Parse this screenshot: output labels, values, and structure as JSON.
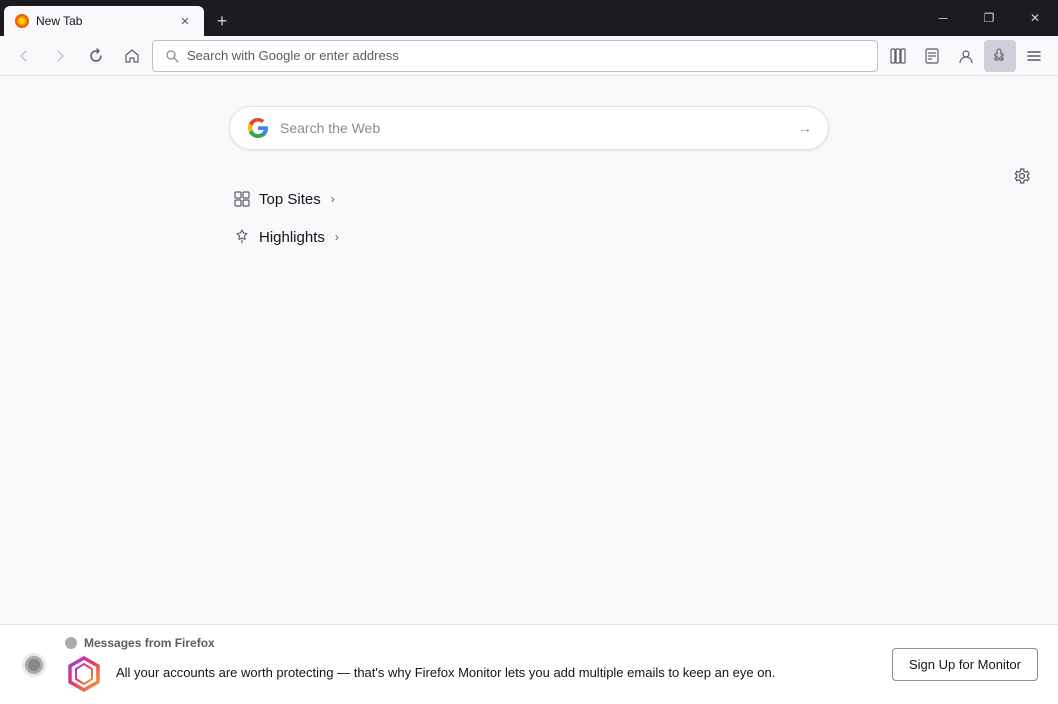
{
  "titlebar": {
    "tab": {
      "title": "New Tab",
      "favicon_char": "🦊"
    },
    "new_tab_label": "+",
    "window_controls": {
      "minimize": "─",
      "restore": "❐",
      "close": "✕"
    }
  },
  "toolbar": {
    "back_label": "←",
    "forward_label": "→",
    "reload_label": "↻",
    "home_label": "⌂",
    "address_placeholder": "Search with Google or enter address",
    "bookmarks_icon": "📚",
    "reader_icon": "📖",
    "account_icon": "👤",
    "extensions_icon": "🧩",
    "menu_icon": "≡"
  },
  "main": {
    "search_placeholder": "Search the Web",
    "sections": [
      {
        "id": "top-sites",
        "label": "Top Sites",
        "icon": "grid"
      },
      {
        "id": "highlights",
        "label": "Highlights",
        "icon": "sparkle"
      }
    ]
  },
  "banner": {
    "title": "Messages from Firefox",
    "text": "All your accounts are worth protecting — that's why Firefox Monitor lets you add multiple emails to keep an eye on.",
    "signup_label": "Sign Up for Monitor"
  },
  "settings": {
    "icon_label": "⚙"
  }
}
